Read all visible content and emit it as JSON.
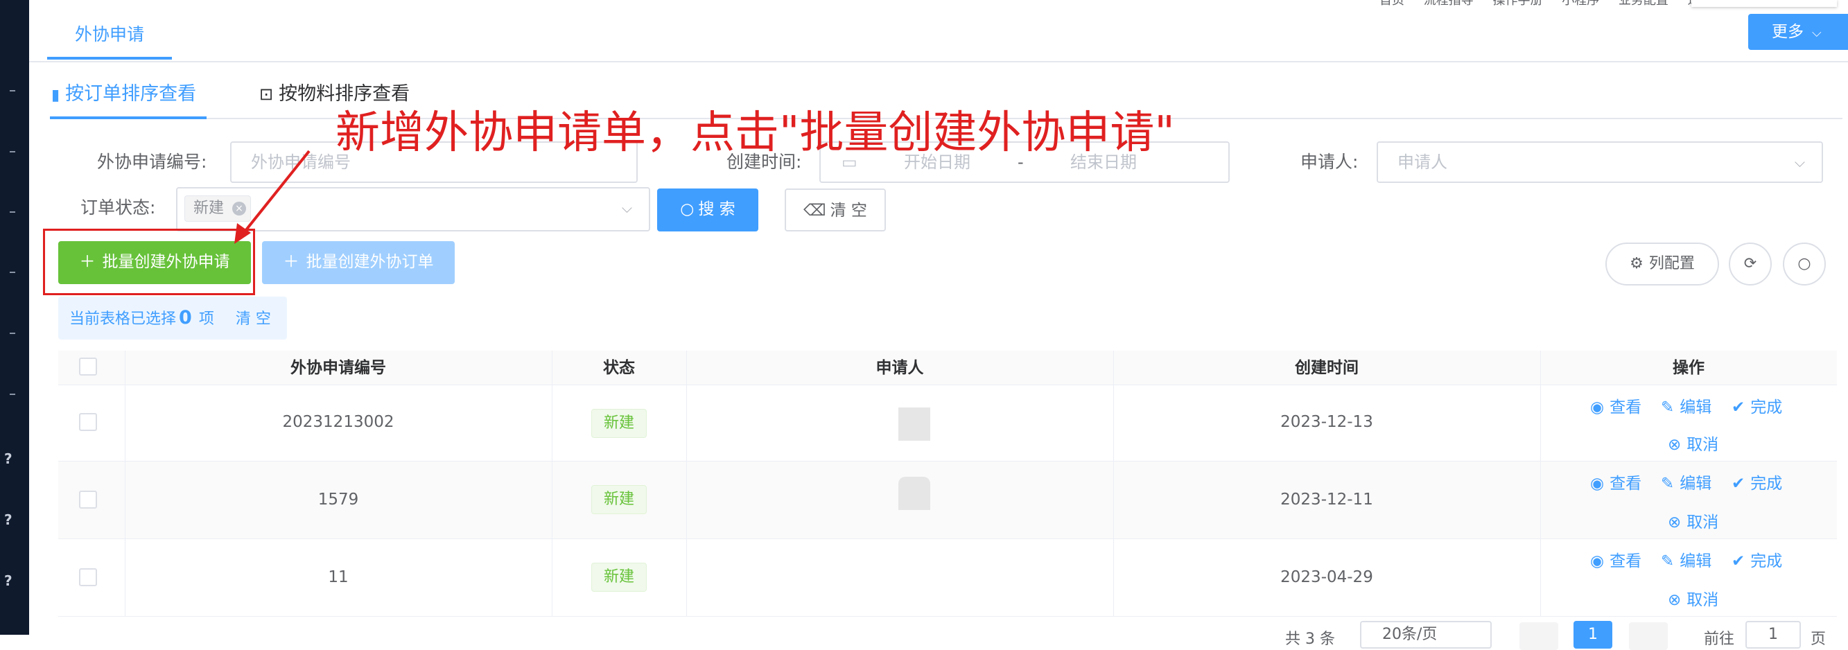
{
  "top_nav": {
    "items": [
      "首页",
      "流程指导",
      "操作手册",
      "小程序",
      "业务配置",
      "通知"
    ]
  },
  "page_tab": {
    "label": "外协申请"
  },
  "more_button": {
    "label": "更多"
  },
  "sub_tabs": [
    {
      "label": "按订单排序查看",
      "active": true
    },
    {
      "label": "按物料排序查看",
      "active": false
    }
  ],
  "filters": {
    "apply_no_label": "外协申请编号:",
    "apply_no_placeholder": "外协申请编号",
    "created_label": "创建时间:",
    "start_placeholder": "开始日期",
    "range_sep": "-",
    "end_placeholder": "结束日期",
    "applicant_label": "申请人:",
    "applicant_placeholder": "申请人",
    "order_status_label": "订单状态:",
    "order_status_tag": "新建"
  },
  "buttons": {
    "search": "搜 索",
    "clear": "清 空",
    "batch_create_apply": "批量创建外协申请",
    "batch_create_order": "批量创建外协订单",
    "column_config": "列配置"
  },
  "selection_alert": {
    "prefix": "当前表格已选择",
    "count": "0",
    "unit": "项",
    "clear": "清 空"
  },
  "annotation": {
    "text": "新增外协申请单，点击\"批量创建外协申请\""
  },
  "table": {
    "headers": [
      "外协申请编号",
      "状态",
      "申请人",
      "创建时间",
      "操作"
    ],
    "rows": [
      {
        "apply_no": "20231213002",
        "status": "新建",
        "created": "2023-12-13"
      },
      {
        "apply_no": "1579",
        "status": "新建",
        "created": "2023-12-11"
      },
      {
        "apply_no": "11",
        "status": "新建",
        "created": "2023-04-29"
      }
    ],
    "actions": {
      "view": "查看",
      "edit": "编辑",
      "complete": "完成",
      "cancel": "取消"
    }
  },
  "pagination": {
    "total": "共 3 条",
    "page_size": "20条/页",
    "current_page": "1",
    "goto": "前往",
    "page_input": "1",
    "page_unit": "页"
  },
  "colors": {
    "primary": "#409eff",
    "success": "#67c23a",
    "annotation": "#e02020",
    "sidebar": "#0f1a2d"
  }
}
